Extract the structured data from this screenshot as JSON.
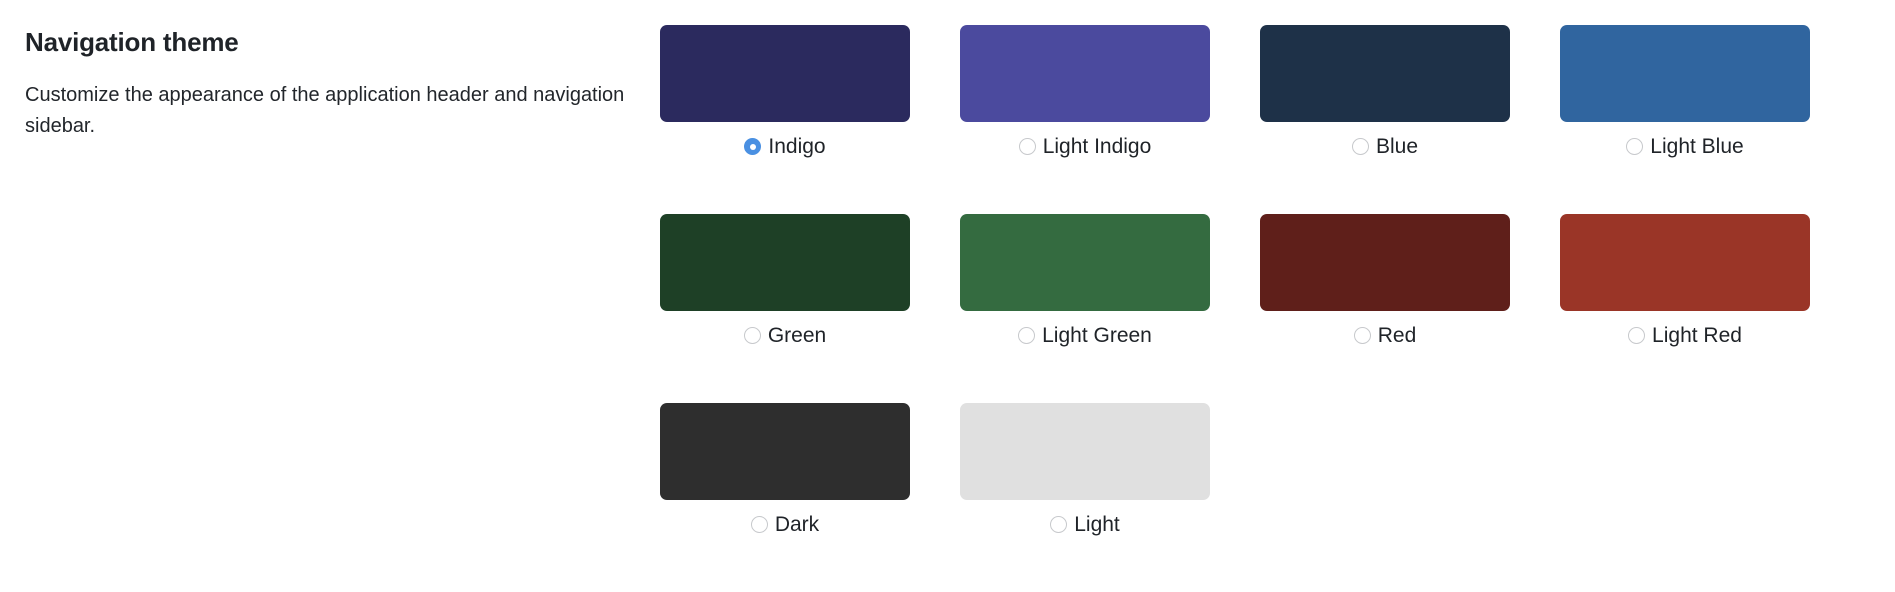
{
  "section": {
    "title": "Navigation theme",
    "description": "Customize the appearance of the application header and navigation sidebar."
  },
  "accent_color": "#4a90e2",
  "selected_theme": "Indigo",
  "themes": [
    {
      "label": "Indigo",
      "color": "#2b2a5e",
      "selected": true
    },
    {
      "label": "Light Indigo",
      "color": "#4b4a9e",
      "selected": false
    },
    {
      "label": "Blue",
      "color": "#1e3148",
      "selected": false
    },
    {
      "label": "Light Blue",
      "color": "#30659f",
      "selected": false
    },
    {
      "label": "Green",
      "color": "#1e4026",
      "selected": false
    },
    {
      "label": "Light Green",
      "color": "#346b40",
      "selected": false
    },
    {
      "label": "Red",
      "color": "#5f1f1a",
      "selected": false
    },
    {
      "label": "Light Red",
      "color": "#9a3527",
      "selected": false
    },
    {
      "label": "Dark",
      "color": "#2e2e2e",
      "selected": false
    },
    {
      "label": "Light",
      "color": "#e0e0e0",
      "selected": false
    }
  ]
}
